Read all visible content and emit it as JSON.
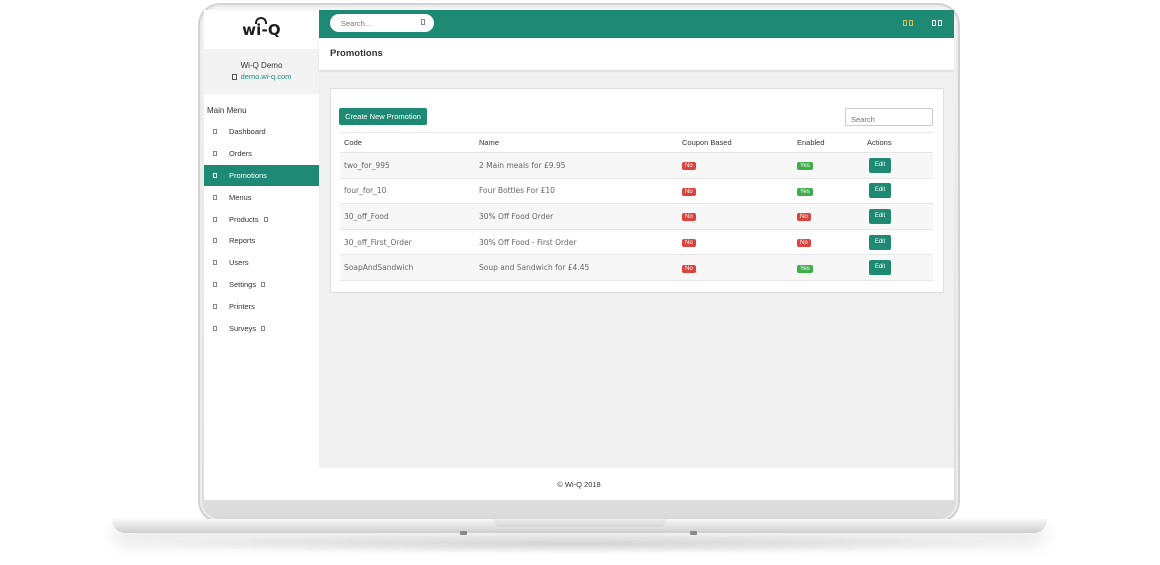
{
  "app": {
    "logo_text": "wi-Q",
    "accent_color": "#1f8a74"
  },
  "user": {
    "name": "Wi-Q Demo",
    "site": "demo.wi-q.com"
  },
  "sidebar": {
    "menu_title": "Main Menu",
    "items": [
      {
        "label": "Dashboard",
        "has_caret": false
      },
      {
        "label": "Orders",
        "has_caret": false
      },
      {
        "label": "Promotions",
        "has_caret": false,
        "active": true
      },
      {
        "label": "Menus",
        "has_caret": false
      },
      {
        "label": "Products",
        "has_caret": true
      },
      {
        "label": "Reports",
        "has_caret": false
      },
      {
        "label": "Users",
        "has_caret": false
      },
      {
        "label": "Settings",
        "has_caret": true
      },
      {
        "label": "Printers",
        "has_caret": false
      },
      {
        "label": "Surveys",
        "has_caret": true
      }
    ]
  },
  "topbar": {
    "search_placeholder": "Search...",
    "icons": [
      "notification-icon",
      "user-menu-icon"
    ]
  },
  "page": {
    "title": "Promotions"
  },
  "toolbar": {
    "create_label": "Create New Promotion",
    "search_placeholder": "Search"
  },
  "table": {
    "columns": [
      "Code",
      "Name",
      "Coupon Based",
      "Enabled",
      "Actions"
    ],
    "rows": [
      {
        "code": "two_for_995",
        "name": "2 Main meals for £9.95",
        "coupon": "No",
        "enabled": "Yes",
        "action": "Edit"
      },
      {
        "code": "four_for_10",
        "name": "Four Bottles For £10",
        "coupon": "No",
        "enabled": "Yes",
        "action": "Edit"
      },
      {
        "code": "30_off_Food",
        "name": "30% Off Food Order",
        "coupon": "No",
        "enabled": "No",
        "action": "Edit"
      },
      {
        "code": "30_off_First_Order",
        "name": "30% Off Food - First Order",
        "coupon": "No",
        "enabled": "No",
        "action": "Edit"
      },
      {
        "code": "SoapAndSandwich",
        "name": "Soup and Sandwich for £4.45",
        "coupon": "No",
        "enabled": "Yes",
        "action": "Edit"
      }
    ]
  },
  "footer": {
    "text": "© Wi-Q 2018"
  }
}
